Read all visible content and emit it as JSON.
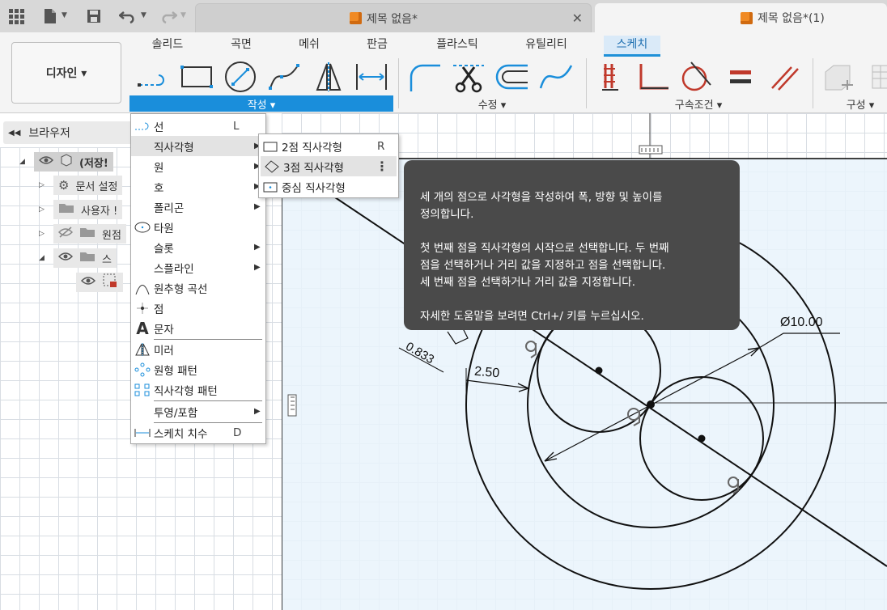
{
  "titlebar": {
    "tabs": [
      {
        "label": "제목 없음*"
      },
      {
        "label": "제목 없음*(1)"
      }
    ]
  },
  "ribbon": {
    "tabs": [
      "솔리드",
      "곡면",
      "메쉬",
      "판금",
      "플라스틱",
      "유틸리티",
      "스케치"
    ],
    "active_tab": "스케치",
    "workspace_button": "디자인 ▾",
    "groups": {
      "create": "작성 ▾",
      "modify": "수정 ▾",
      "constraints": "구속조건 ▾",
      "construct": "구성 ▾"
    }
  },
  "browser": {
    "header": "브라우저",
    "items": [
      {
        "label": "(저장!"
      },
      {
        "label": "문서 설정"
      },
      {
        "label": "사용자 !"
      },
      {
        "label": "원점"
      },
      {
        "label": "스"
      }
    ]
  },
  "create_menu": {
    "items": [
      {
        "label": "선",
        "shortcut": "L"
      },
      {
        "label": "직사각형",
        "submenu": true
      },
      {
        "label": "원",
        "submenu": true
      },
      {
        "label": "호",
        "submenu": true
      },
      {
        "label": "폴리곤",
        "submenu": true
      },
      {
        "label": "타원"
      },
      {
        "label": "슬롯",
        "submenu": true
      },
      {
        "label": "스플라인",
        "submenu": true
      },
      {
        "label": "원추형 곡선"
      },
      {
        "label": "점"
      },
      {
        "label": "문자"
      },
      {
        "label": "미러"
      },
      {
        "label": "원형 패턴"
      },
      {
        "label": "직사각형 패턴"
      },
      {
        "label": "투영/포함",
        "submenu": true
      },
      {
        "label": "스케치 치수",
        "shortcut": "D"
      }
    ]
  },
  "rectangle_submenu": {
    "items": [
      {
        "label": "2점 직사각형",
        "shortcut": "R"
      },
      {
        "label": "3점 직사각형",
        "more": "⋮"
      },
      {
        "label": "중심 직사각형"
      }
    ]
  },
  "tooltip": {
    "line1": "세 개의 점으로 사각형을 작성하여 폭, 방향 및 높이를",
    "line2": "정의합니다.",
    "para2_line1": "첫 번째 점을 직사각형의 시작으로 선택합니다. 두 번째",
    "para2_line2": "점을 선택하거나 거리 값을 지정하고 점을 선택합니다.",
    "para2_line3": "세 번째 점을 선택하거나 거리 값을 지정합니다.",
    "help_line": "자세한 도움말을 보려면 Ctrl+/ 키를 누르십시오."
  },
  "sketch": {
    "dimensions": {
      "diameter": "Ø10.00",
      "distance": "2.50",
      "small": "0.833"
    }
  },
  "colors": {
    "accent": "#1a8edb",
    "sketch_red": "#c0392b",
    "tooltip_bg": "#4a4a4a"
  }
}
